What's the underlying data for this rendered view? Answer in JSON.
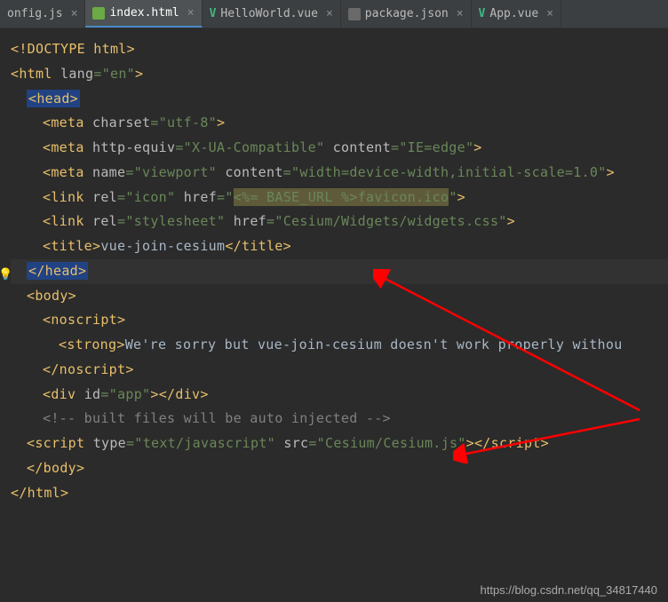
{
  "tabs": [
    {
      "label": "onfig.js",
      "icon": "js"
    },
    {
      "label": "index.html",
      "icon": "html",
      "active": true
    },
    {
      "label": "HelloWorld.vue",
      "icon": "vue"
    },
    {
      "label": "package.json",
      "icon": "json"
    },
    {
      "label": "App.vue",
      "icon": "vue"
    }
  ],
  "code": {
    "doctype": "<!DOCTYPE html>",
    "html_open": "html",
    "html_lang_attr": "lang",
    "html_lang_val": "\"en\"",
    "head_open": "<head>",
    "meta_charset_tag": "meta",
    "meta_charset_attr": "charset",
    "meta_charset_val": "\"utf-8\"",
    "meta_http_tag": "meta",
    "meta_http_attr1": "http-equiv",
    "meta_http_val1": "\"X-UA-Compatible\"",
    "meta_http_attr2": "content",
    "meta_http_val2": "\"IE=edge\"",
    "meta_vp_tag": "meta",
    "meta_vp_attr1": "name",
    "meta_vp_val1": "\"viewport\"",
    "meta_vp_attr2": "content",
    "meta_vp_val2": "\"width=device-width,initial-scale=1.0\"",
    "link1_tag": "link",
    "link1_attr1": "rel",
    "link1_val1": "\"icon\"",
    "link1_attr2": "href",
    "link1_val2a": "\"",
    "link1_val2b": "<%= BASE_URL %>",
    "link1_val2c": "favicon.ico",
    "link1_val2d": "\"",
    "link2_tag": "link",
    "link2_attr1": "rel",
    "link2_val1": "\"stylesheet\"",
    "link2_attr2": "href",
    "link2_val2": "\"Cesium/Widgets/widgets.css\"",
    "title_tag": "title",
    "title_text": "vue-join-cesium",
    "head_close": "</head>",
    "body_open": "body",
    "noscript_open": "noscript",
    "strong_tag": "strong",
    "strong_text": "We're sorry but vue-join-cesium doesn't work properly withou",
    "noscript_close": "noscript",
    "div_tag": "div",
    "div_attr": "id",
    "div_val": "\"app\"",
    "comment": "<!-- built files will be auto injected -->",
    "script_tag": "script",
    "script_attr1": "type",
    "script_val1": "\"text/javascript\"",
    "script_attr2": "src",
    "script_val2": "\"Cesium/Cesium.js\"",
    "body_close": "body",
    "html_close": "html"
  },
  "watermark": "https://blog.csdn.net/qq_34817440"
}
